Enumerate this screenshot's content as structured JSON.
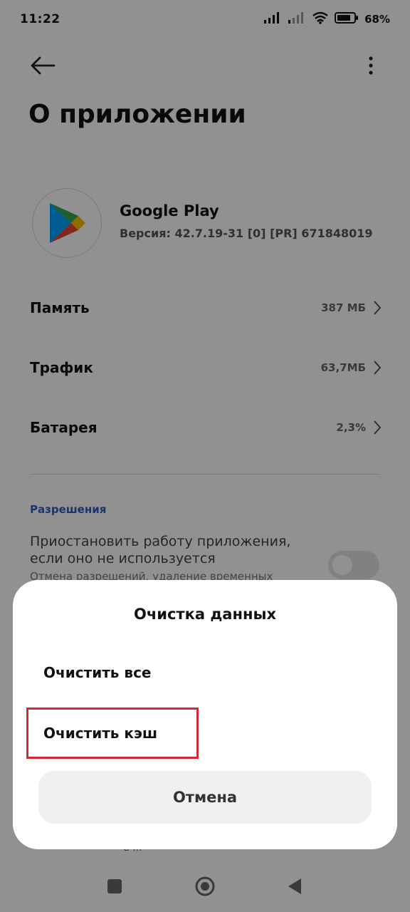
{
  "status_bar": {
    "time": "11:22",
    "battery": "68%",
    "icons": [
      "signal-icon",
      "signal-icon",
      "wifi-icon",
      "battery-icon"
    ]
  },
  "header": {
    "title": "О приложении",
    "back_icon": "arrow-left-icon",
    "more_icon": "more-vertical-icon"
  },
  "app": {
    "name": "Google Play",
    "version": "Версия: 42.7.19-31 [0] [PR] 671848019",
    "icon": "google-play-icon"
  },
  "rows": [
    {
      "label": "Память",
      "value": "387 МБ"
    },
    {
      "label": "Трафик",
      "value": "63,7МБ"
    },
    {
      "label": "Батарея",
      "value": "2,3%"
    }
  ],
  "permissions": {
    "section_label": "Разрешения",
    "title": "Приостановить работу приложения, если оно не используется",
    "subtitle": "Отмена разрешений, удаление временных",
    "toggle_on": false
  },
  "under_sheet_text": "С ...",
  "dialog": {
    "title": "Очистка данных",
    "clear_all": "Очистить все",
    "clear_cache": "Очистить кэш",
    "cancel": "Отмена",
    "highlight_color": "#d32a35"
  },
  "navbar": {
    "icons": [
      "recents-square-icon",
      "home-circle-icon",
      "back-triangle-icon"
    ]
  }
}
